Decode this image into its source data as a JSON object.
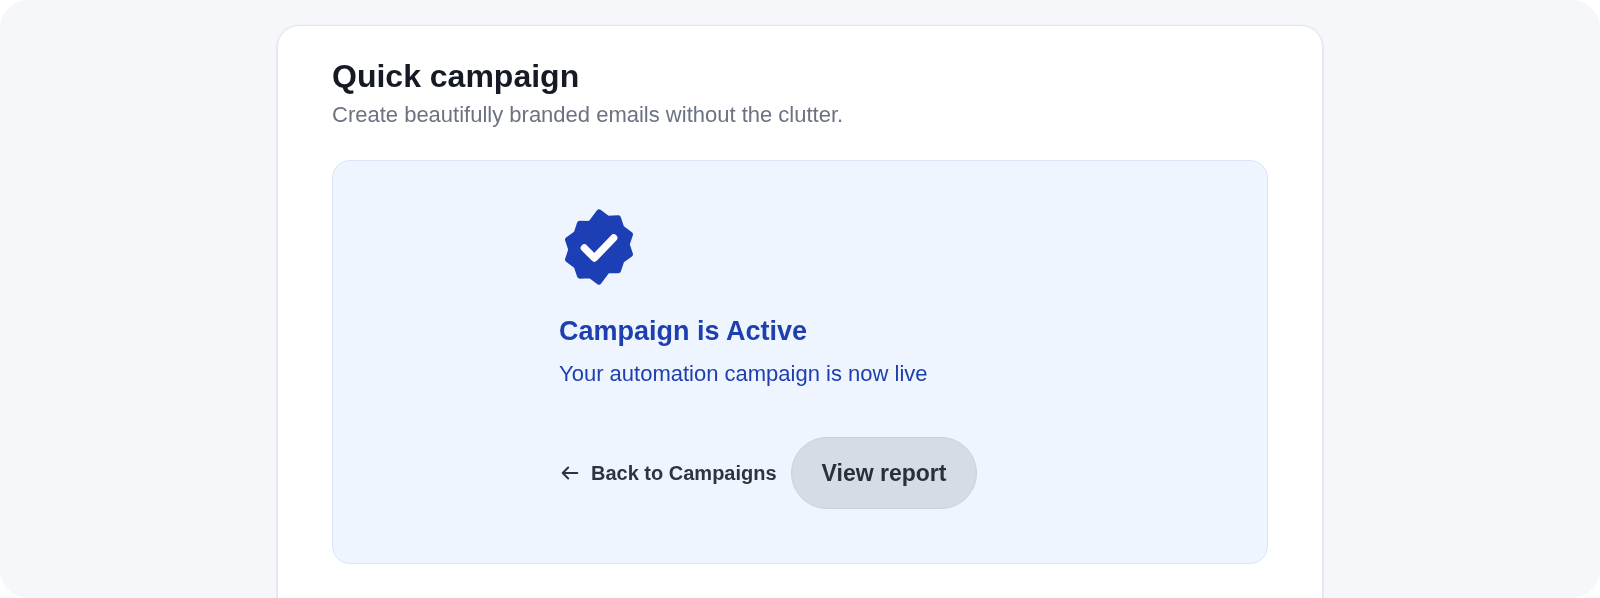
{
  "card": {
    "title": "Quick campaign",
    "subtitle": "Create beautifully branded emails without the clutter."
  },
  "status": {
    "title": "Campaign is Active",
    "message": "Your automation campaign is now live"
  },
  "actions": {
    "back_link": "Back to Campaigns",
    "primary_button": "View report"
  }
}
